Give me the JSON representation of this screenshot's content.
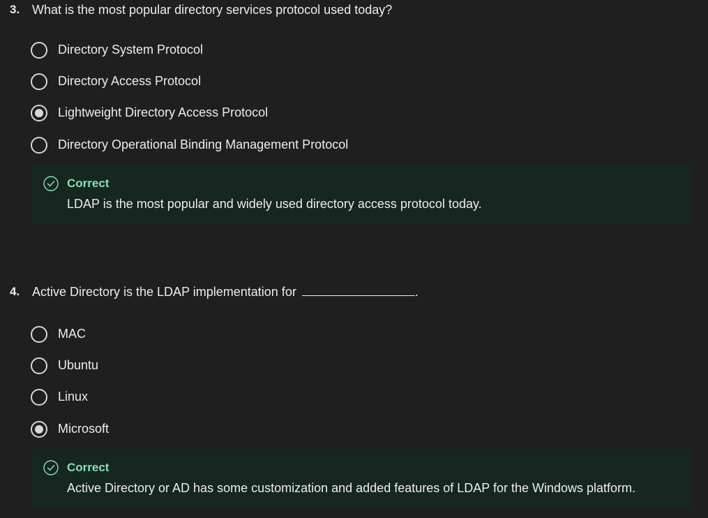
{
  "questions": [
    {
      "number": "3.",
      "text": "What is the most popular directory services protocol used today?",
      "options": [
        {
          "label": "Directory System Protocol",
          "selected": false
        },
        {
          "label": "Directory Access Protocol",
          "selected": false
        },
        {
          "label": "Lightweight Directory Access Protocol",
          "selected": true
        },
        {
          "label": "Directory Operational Binding Management Protocol",
          "selected": false
        }
      ],
      "feedback": {
        "title": "Correct",
        "body": "LDAP is the most popular and widely used directory access protocol today.",
        "icon": "check-circle-icon"
      }
    },
    {
      "number": "4.",
      "text": "Active Directory is the LDAP implementation for",
      "text_end": ".",
      "options": [
        {
          "label": "MAC",
          "selected": false
        },
        {
          "label": "Ubuntu",
          "selected": false
        },
        {
          "label": "Linux",
          "selected": false
        },
        {
          "label": "Microsoft",
          "selected": true
        }
      ],
      "feedback": {
        "title": "Correct",
        "body": "Active Directory or AD has some customization and added features of LDAP for the Windows platform.",
        "icon": "check-circle-icon"
      }
    }
  ],
  "colors": {
    "background": "#1f1f1f",
    "feedback_bg": "#162621",
    "correct_accent": "#86e1b5",
    "text": "#ededed",
    "radio": "#d8d8d8"
  }
}
